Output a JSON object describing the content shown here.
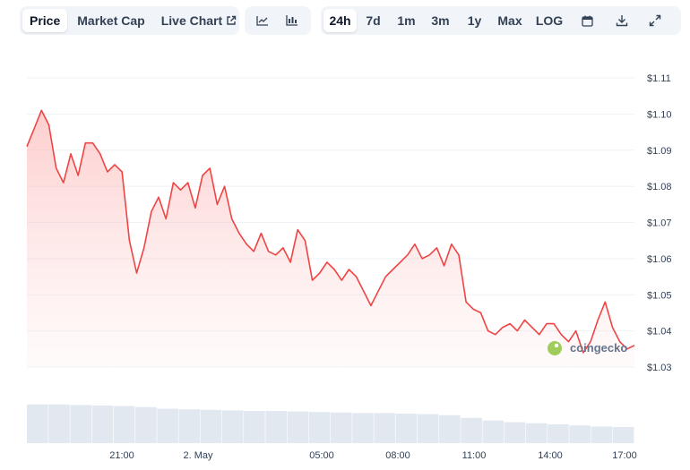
{
  "toolbar": {
    "metric_tabs": [
      "Price",
      "Market Cap",
      "Live Chart"
    ],
    "range_tabs": [
      "24h",
      "7d",
      "1m",
      "3m",
      "1y",
      "Max",
      "LOG"
    ],
    "active_metric": "Price",
    "active_range": "24h",
    "icons": [
      "external-link-icon",
      "line-chart-icon",
      "candlestick-chart-icon",
      "calendar-icon",
      "download-icon",
      "expand-icon"
    ]
  },
  "watermark": "coingecko",
  "colors": {
    "line": "#ef4444",
    "fill_top": "#fca5a5",
    "volume": "#e2e8f0",
    "grid": "#eef2f6",
    "active_bg": "#ffffff",
    "group_bg": "#f1f5f9"
  },
  "chart_data": {
    "type": "area",
    "y_ticks": [
      "$1.11",
      "$1.10",
      "$1.09",
      "$1.08",
      "$1.07",
      "$1.06",
      "$1.05",
      "$1.04",
      "$1.03"
    ],
    "x_ticks": [
      "21:00",
      "2. May",
      "05:00",
      "08:00",
      "11:00",
      "14:00",
      "17:00"
    ],
    "ylim": [
      1.03,
      1.11
    ],
    "grid": true,
    "series": [
      {
        "values": [
          1.091,
          1.096,
          1.101,
          1.097,
          1.085,
          1.081,
          1.089,
          1.083,
          1.092,
          1.092,
          1.089,
          1.084,
          1.086,
          1.084,
          1.065,
          1.056,
          1.063,
          1.073,
          1.077,
          1.071,
          1.081,
          1.079,
          1.081,
          1.074,
          1.083,
          1.085,
          1.075,
          1.08,
          1.071,
          1.067,
          1.064,
          1.062,
          1.067,
          1.062,
          1.061,
          1.063,
          1.059,
          1.068,
          1.065,
          1.054,
          1.056,
          1.059,
          1.057,
          1.054,
          1.057,
          1.055,
          1.051,
          1.047,
          1.051,
          1.055,
          1.057,
          1.059,
          1.061,
          1.064,
          1.06,
          1.061,
          1.063,
          1.058,
          1.064,
          1.061,
          1.048,
          1.046,
          1.045,
          1.04,
          1.039,
          1.041,
          1.042,
          1.04,
          1.043,
          1.041,
          1.039,
          1.042,
          1.042,
          1.039,
          1.037,
          1.04,
          1.034,
          1.037,
          1.043,
          1.048,
          1.041,
          1.037,
          1.035,
          1.036
        ]
      }
    ],
    "volume": [
      0.72,
      0.72,
      0.71,
      0.7,
      0.69,
      0.67,
      0.64,
      0.63,
      0.62,
      0.61,
      0.6,
      0.6,
      0.59,
      0.58,
      0.57,
      0.56,
      0.56,
      0.55,
      0.54,
      0.52,
      0.47,
      0.42,
      0.39,
      0.37,
      0.35,
      0.33,
      0.31,
      0.3
    ]
  }
}
